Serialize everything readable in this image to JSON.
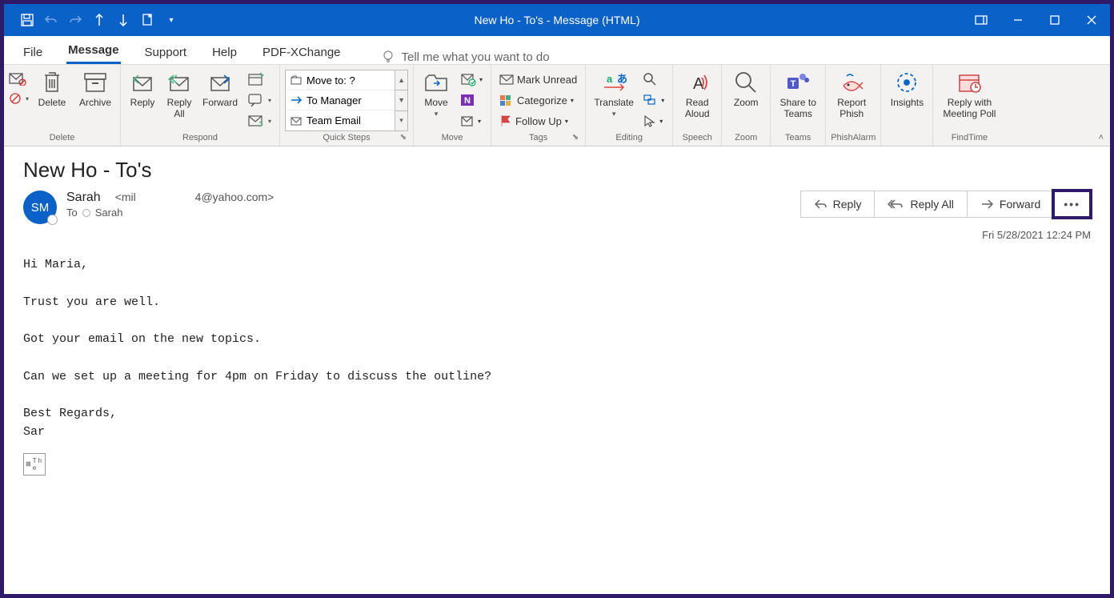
{
  "window": {
    "title": "New Ho - To's  -  Message (HTML)"
  },
  "tabs": {
    "file": "File",
    "message": "Message",
    "support": "Support",
    "help": "Help",
    "pdf": "PDF-XChange",
    "tellme": "Tell me what you want to do"
  },
  "ribbon": {
    "delete": {
      "delete": "Delete",
      "archive": "Archive",
      "group": "Delete"
    },
    "respond": {
      "reply": "Reply",
      "replyall": "Reply\nAll",
      "forward": "Forward",
      "group": "Respond"
    },
    "quicksteps": {
      "item1": "Move to: ?",
      "item2": "To Manager",
      "item3": "Team Email",
      "group": "Quick Steps"
    },
    "move": {
      "move": "Move",
      "group": "Move"
    },
    "tags": {
      "unread": "Mark Unread",
      "categorize": "Categorize",
      "followup": "Follow Up",
      "group": "Tags"
    },
    "editing": {
      "translate": "Translate",
      "group": "Editing"
    },
    "speech": {
      "read": "Read\nAloud",
      "group": "Speech"
    },
    "zoom": {
      "zoom": "Zoom",
      "group": "Zoom"
    },
    "teams": {
      "share": "Share to\nTeams",
      "group": "Teams"
    },
    "phish": {
      "report": "Report\nPhish",
      "group": "PhishAlarm"
    },
    "insights": {
      "insights": "Insights"
    },
    "findtime": {
      "meeting": "Reply with\nMeeting Poll",
      "group": "FindTime"
    }
  },
  "message": {
    "subject": "New Ho - To's",
    "avatar": "SM",
    "senderName": "Sarah",
    "senderEmail": "<mil                   4@yahoo.com>",
    "toLabel": "To",
    "toName": "Sarah",
    "datetime": "Fri 5/28/2021 12:24 PM",
    "body": "Hi Maria,\n\nTrust you are well.\n\nGot your email on the new topics.\n\nCan we set up a meeting for 4pm on Friday to discuss the outline?\n\nBest Regards,\nSar",
    "attach_stub": "T h e"
  },
  "actions": {
    "reply": "Reply",
    "replyall": "Reply All",
    "forward": "Forward"
  }
}
